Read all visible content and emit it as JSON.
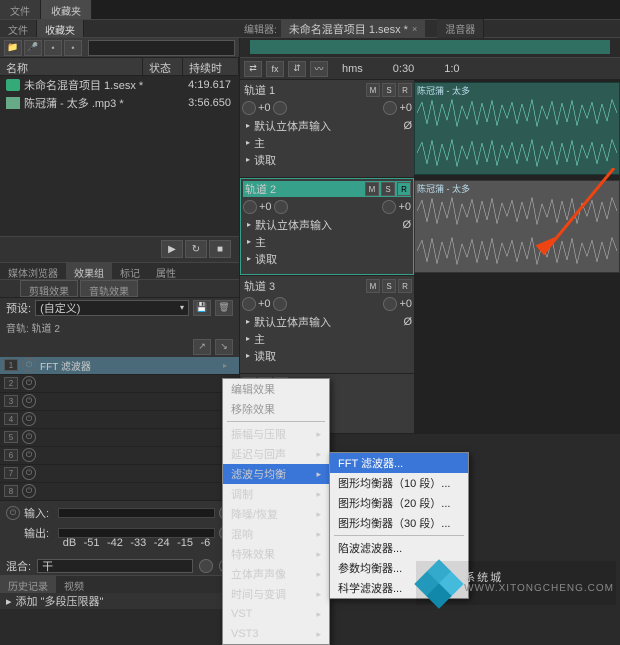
{
  "topbar": {
    "file": "文件",
    "favorites": "收藏夹",
    "editor": "编辑器:",
    "doc": "未命名混音项目 1.sesx *",
    "mixer": "混音器"
  },
  "files": {
    "header": {
      "name": "名称",
      "status": "状态",
      "duration": "持续时间"
    },
    "rows": [
      {
        "name": "未命名混音项目 1.sesx *",
        "duration": "4:19.617"
      },
      {
        "name": "陈冠蒲 - 太多 .mp3 *",
        "duration": "3:56.650"
      }
    ]
  },
  "subTabs": {
    "mediaBrowser": "媒体浏览器",
    "fxGroup": "效果组",
    "marker": "标记",
    "props": "属性"
  },
  "fxSub": {
    "clip": "剪辑效果",
    "track": "音轨效果"
  },
  "preset": {
    "label": "预设:",
    "value": "(自定义)"
  },
  "rack": {
    "trackLabel": "音轨: 轨道 2",
    "fx1": "FFT 滤波器"
  },
  "io": {
    "in": "输入:",
    "out": "输出:",
    "ticks": [
      "dB",
      "-51",
      "-42",
      "-33",
      "-24",
      "-15",
      "-6"
    ]
  },
  "mix": {
    "label": "混合:",
    "value": "干"
  },
  "hist": {
    "history": "历史记录",
    "video": "视频",
    "add": "添加 \"多段压限器\""
  },
  "tracks": {
    "ruler": [
      "hms",
      "0:30",
      "1:0"
    ],
    "t1": {
      "name": "轨道 1",
      "input": "默认立体声输入",
      "master": "主",
      "read": "读取",
      "clip": "陈冠蒲 - 太多"
    },
    "t2": {
      "name": "轨道 2",
      "input": "默认立体声输入",
      "master": "主",
      "read": "读取",
      "clip": "陈冠蒲 - 太多"
    },
    "t3": {
      "name": "轨道 3",
      "input": "默认立体声输入",
      "master": "主",
      "read": "读取"
    },
    "btn": {
      "m": "M",
      "s": "S",
      "r": "R",
      "plus0": "+0"
    }
  },
  "menu": {
    "editFx": "编辑效果",
    "removeFx": "移除效果",
    "amp": "振幅与压限",
    "delay": "延迟与回声",
    "filter": "滤波与均衡",
    "mod": "调制",
    "noise": "降噪/恢复",
    "reverb": "混响",
    "special": "特殊效果",
    "stereo": "立体声声像",
    "time": "时间与变调",
    "vst": "VST",
    "vst3": "VST3"
  },
  "submenu": {
    "fft": "FFT 滤波器...",
    "geq10": "图形均衡器（10 段）...",
    "geq20": "图形均衡器（20 段）...",
    "geq30": "图形均衡器（30 段）...",
    "notch": "陷波滤波器...",
    "param": "参数均衡器...",
    "sci": "科学滤波器..."
  },
  "watermark": {
    "text": "系统城",
    "url": "WWW.XITONGCHENG.COM"
  }
}
